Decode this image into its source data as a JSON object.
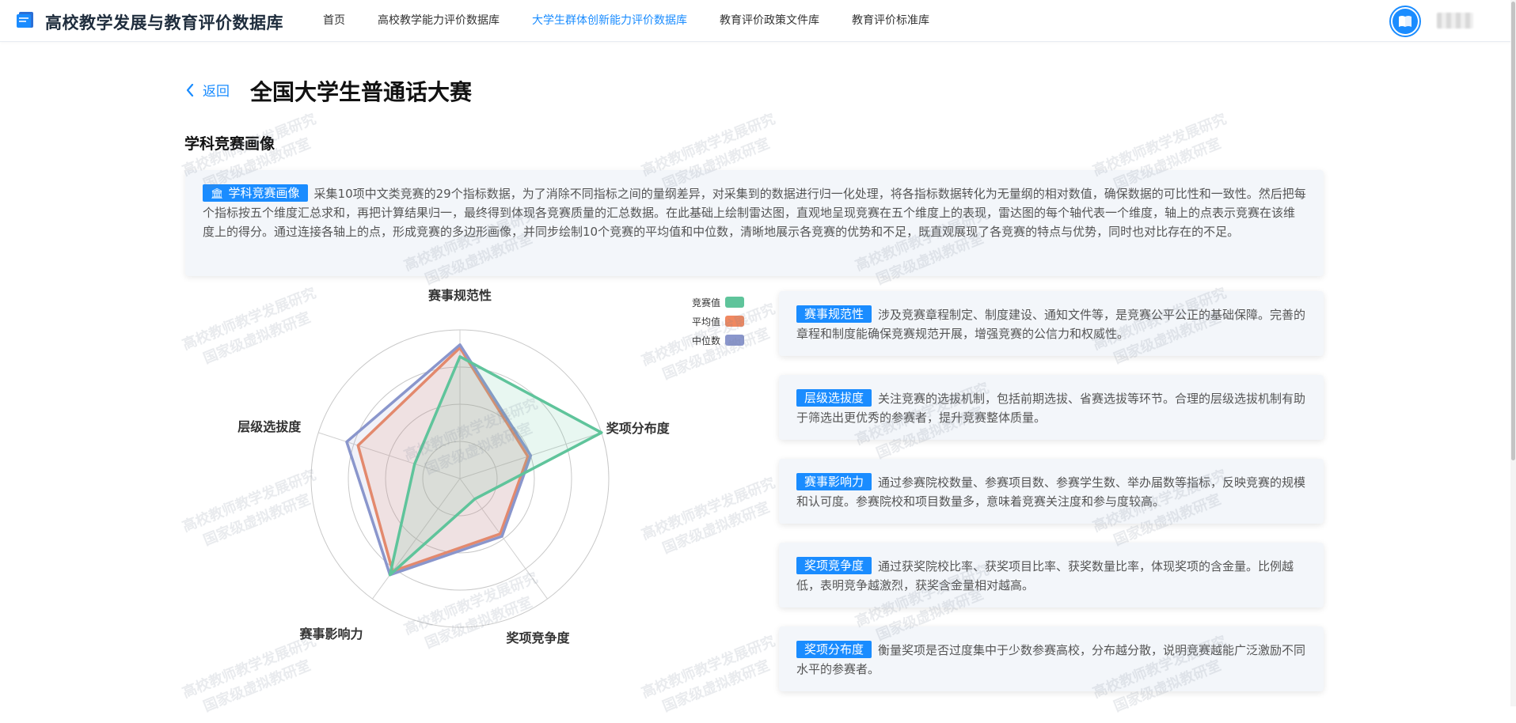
{
  "app": {
    "title": "高校教学发展与教育评价数据库",
    "nav": [
      {
        "label": "首页",
        "active": false
      },
      {
        "label": "高校教学能力评价数据库",
        "active": false
      },
      {
        "label": "大学生群体创新能力评价数据库",
        "active": true
      },
      {
        "label": "教育评价政策文件库",
        "active": false
      },
      {
        "label": "教育评价标准库",
        "active": false
      }
    ],
    "accent_color": "#1a8cff"
  },
  "header": {
    "back_label": "返回",
    "page_title": "全国大学生普通话大赛"
  },
  "section": {
    "title": "学科竞赛画像",
    "intro_tag": "学科竞赛画像",
    "intro_text": "采集10项中文类竞赛的29个指标数据，为了消除不同指标之间的量纲差异，对采集到的数据进行归一化处理，将各指标数据转化为无量纲的相对数值，确保数据的可比性和一致性。然后把每个指标按五个维度汇总求和，再把计算结果归一，最终得到体现各竞赛质量的汇总数据。在此基础上绘制雷达图，直观地呈现竞赛在五个维度上的表现，雷达图的每个轴代表一个维度，轴上的点表示竞赛在该维度上的得分。通过连接各轴上的点，形成竞赛的多边形画像，并同步绘制10个竞赛的平均值和中位数，清晰地展示各竞赛的优势和不足，既直观展现了各竞赛的特点与优势，同时也对比存在的不足。"
  },
  "dimensions": [
    {
      "tag": "赛事规范性",
      "text": "涉及竞赛章程制定、制度建设、通知文件等，是竞赛公平公正的基础保障。完善的章程和制度能确保竞赛规范开展，增强竞赛的公信力和权威性。"
    },
    {
      "tag": "层级选拔度",
      "text": "关注竞赛的选拔机制，包括前期选拔、省赛选拔等环节。合理的层级选拔机制有助于筛选出更优秀的参赛者，提升竞赛整体质量。"
    },
    {
      "tag": "赛事影响力",
      "text": "通过参赛院校数量、参赛项目数、参赛学生数、举办届数等指标，反映竞赛的规模和认可度。参赛院校和项目数量多，意味着竞赛关注度和参与度较高。"
    },
    {
      "tag": "奖项竞争度",
      "text": "通过获奖院校比率、获奖项目比率、获奖数量比率，体现奖项的含金量。比例越低，表明竞争越激烈，获奖含金量相对越高。"
    },
    {
      "tag": "奖项分布度",
      "text": "衡量奖项是否过度集中于少数参赛高校，分布越分散，说明竞赛越能广泛激励不同水平的参赛者。"
    }
  ],
  "watermark": {
    "line1": "高校教师教学发展研究",
    "line2": "国家级虚拟教研室"
  },
  "chart_data": {
    "type": "radar",
    "indicators": [
      "赛事规范性",
      "奖项分布度",
      "奖项竞争度",
      "赛事影响力",
      "层级选拔度"
    ],
    "max": 1,
    "series": [
      {
        "name": "竞赛值",
        "color": "#5fc49b",
        "values": [
          0.82,
          1.0,
          0.17,
          0.8,
          0.32
        ]
      },
      {
        "name": "平均值",
        "color": "#f08860",
        "values": [
          0.88,
          0.48,
          0.46,
          0.77,
          0.72
        ]
      },
      {
        "name": "中位数",
        "color": "#8a96cc",
        "values": [
          0.9,
          0.5,
          0.48,
          0.8,
          0.8
        ]
      }
    ]
  }
}
